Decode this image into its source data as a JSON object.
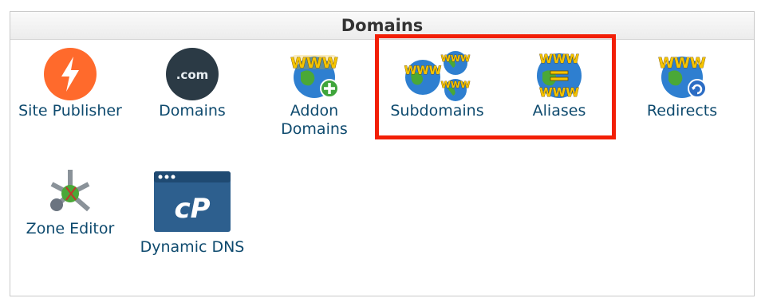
{
  "panel": {
    "title": "Domains"
  },
  "items": [
    {
      "label": "Site Publisher",
      "icon": "lightning-bolt-icon"
    },
    {
      "label": "Domains",
      "icon": "dot-com-icon",
      "badge": ".com"
    },
    {
      "label": "Addon Domains",
      "label_line1": "Addon",
      "label_line2": "Domains",
      "icon": "www-globe-plus-icon",
      "badge": "WWW"
    },
    {
      "label": "Subdomains",
      "icon": "www-globes-cluster-icon",
      "badge": "WWW"
    },
    {
      "label": "Aliases",
      "icon": "www-equals-globe-icon",
      "badge": "WWW"
    },
    {
      "label": "Redirects",
      "icon": "www-globe-redirect-icon",
      "badge": "WWW"
    },
    {
      "label": "Zone Editor",
      "icon": "zone-editor-network-icon"
    },
    {
      "label": "Dynamic DNS",
      "icon": "cpanel-window-icon",
      "badge": "cP"
    }
  ],
  "highlight_color": "#f21f06",
  "label_color": "#0e4a6e"
}
